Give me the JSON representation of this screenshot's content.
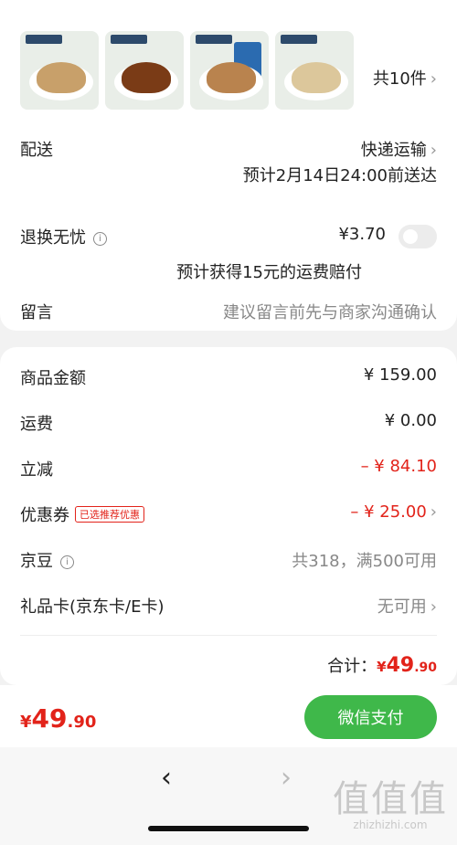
{
  "products": {
    "count_label": "共10件",
    "items": [
      {
        "name": "walnut-pack-icon"
      },
      {
        "name": "caramel-walnut-pack-icon"
      },
      {
        "name": "almond-pack-icon"
      },
      {
        "name": "peanut-pack-icon"
      }
    ]
  },
  "delivery": {
    "label": "配送",
    "method": "快递运输",
    "estimate": "预计2月14日24:00前送达"
  },
  "return_insurance": {
    "label": "退换无忧",
    "price": "¥3.70",
    "note": "预计获得15元的运费赔付",
    "enabled": false
  },
  "message": {
    "label": "留言",
    "placeholder": "建议留言前先与商家沟通确认"
  },
  "summary": {
    "goods_label": "商品金额",
    "goods_value": "¥ 159.00",
    "shipping_label": "运费",
    "shipping_value": "¥ 0.00",
    "discount_label": "立减",
    "discount_value": "– ¥ 84.10",
    "coupon_label": "优惠券",
    "coupon_tag": "已选推荐优惠",
    "coupon_value": "– ¥ 25.00",
    "jingdou_label": "京豆",
    "jingdou_value": "共318，满500可用",
    "giftcard_label": "礼品卡(京东卡/E卡)",
    "giftcard_value": "无可用",
    "total_label": "合计：",
    "total_currency": "¥",
    "total_int": "49",
    "total_dec": ".90"
  },
  "bottom": {
    "currency": "¥",
    "price_int": "49",
    "price_dec": ".90",
    "pay_label": "微信支付"
  },
  "watermark": {
    "big": "值值值",
    "small": "zhizhizhi.com"
  },
  "colors": {
    "accent_red": "#e2231a",
    "pay_green": "#3fb84a"
  }
}
